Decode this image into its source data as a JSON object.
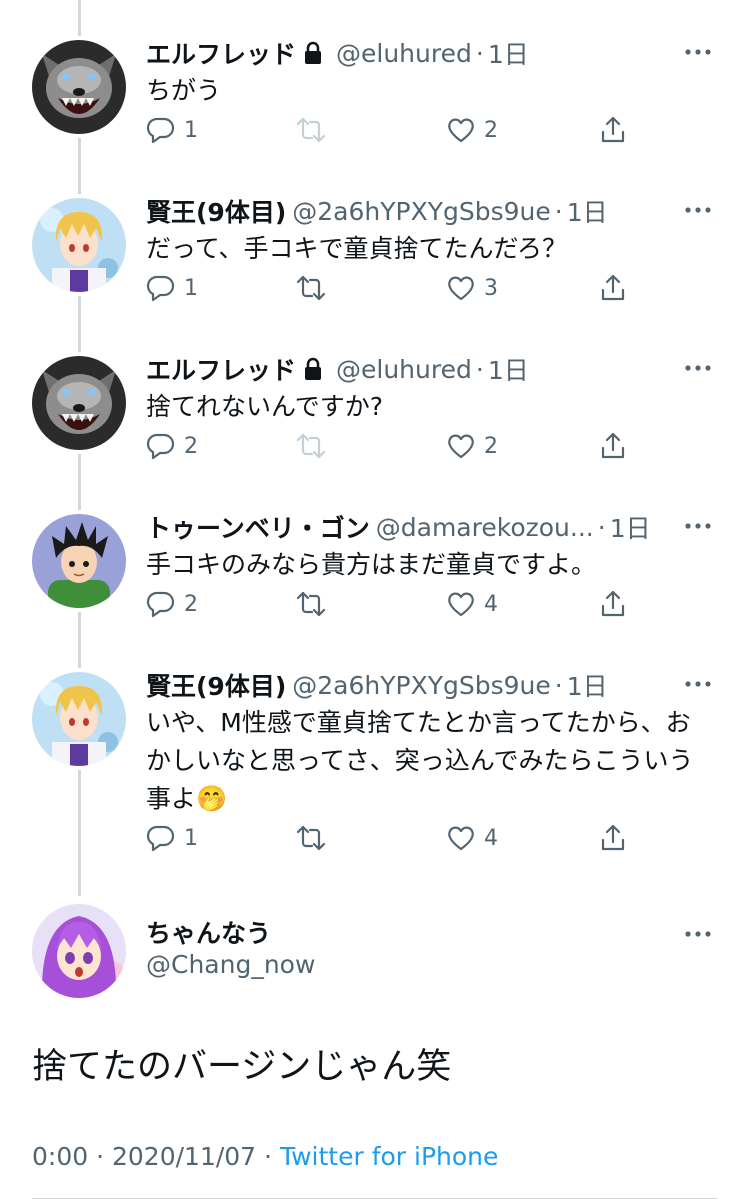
{
  "replies": [
    {
      "name": "エルフレッド",
      "protected": true,
      "handle": "@eluhured",
      "time": "1日",
      "text": "ちがう",
      "avatar": "wolf",
      "counts": {
        "reply": "1",
        "retweet": "",
        "like": "2"
      },
      "retweet_disabled": true
    },
    {
      "name": "賢王(9体目)",
      "protected": false,
      "handle": "@2a6hYPXYgSbs9ue",
      "time": "1日",
      "text": "だって、手コキで童貞捨てたんだろ？",
      "avatar": "blonde",
      "counts": {
        "reply": "1",
        "retweet": "",
        "like": "3"
      },
      "retweet_disabled": false
    },
    {
      "name": "エルフレッド",
      "protected": true,
      "handle": "@eluhured",
      "time": "1日",
      "text": "捨てれないんですか?",
      "avatar": "wolf",
      "counts": {
        "reply": "2",
        "retweet": "",
        "like": "2"
      },
      "retweet_disabled": true
    },
    {
      "name": "トゥーンベリ・ゴン",
      "protected": false,
      "handle": "@damarekozou...",
      "time": "1日",
      "text": "手コキのみなら貴方はまだ童貞ですよ。",
      "avatar": "boy",
      "counts": {
        "reply": "2",
        "retweet": "",
        "like": "4"
      },
      "retweet_disabled": false
    },
    {
      "name": "賢王(9体目)",
      "protected": false,
      "handle": "@2a6hYPXYgSbs9ue",
      "time": "1日",
      "text": "いや、M性感で童貞捨てたとか言ってたから、おかしいなと思ってさ、突っ込んでみたらこういう事よ🤭",
      "avatar": "blonde",
      "counts": {
        "reply": "1",
        "retweet": "",
        "like": "4"
      },
      "retweet_disabled": false
    }
  ],
  "main_tweet": {
    "name": "ちゃんなう",
    "handle": "@Chang_now",
    "text": "捨てたのバージンじゃん笑",
    "time": "0:00",
    "date": "2020/11/07",
    "source": "Twitter for iPhone",
    "separator": "·"
  },
  "icons": {
    "lock": "lock-icon",
    "more": "more-icon",
    "reply": "reply-icon",
    "retweet": "retweet-icon",
    "like": "heart-icon",
    "share": "share-icon"
  },
  "colors": {
    "text": "#0f1419",
    "secondary": "#536471",
    "link": "#1d9bf0",
    "line": "#cfd9de",
    "disabled": "#c4cfd6"
  }
}
